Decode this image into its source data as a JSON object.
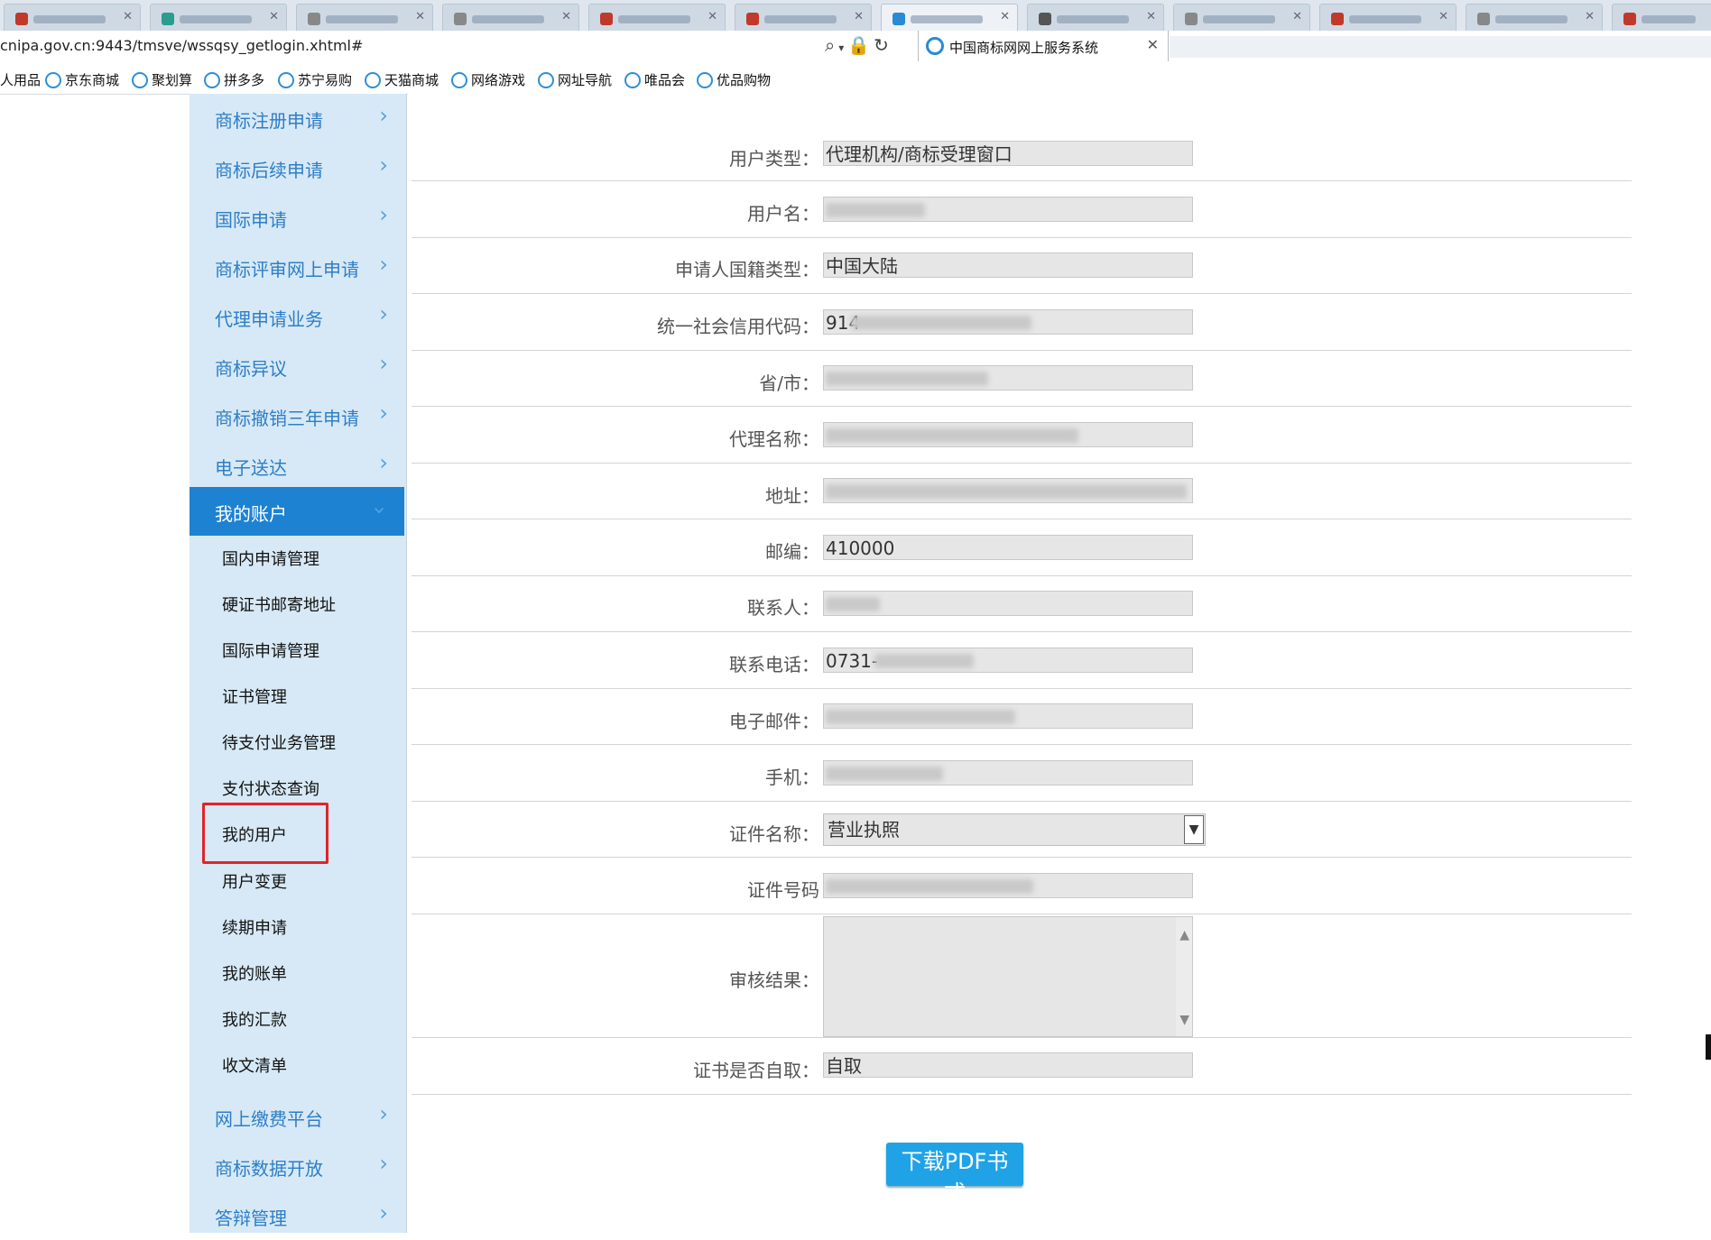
{
  "browser": {
    "url_visible": "cnipa.gov.cn:9443/tmsve/wssqsy_getlogin.xhtml#",
    "active_tab_title": "中国商标网网上服务系统",
    "favorites": [
      "人用品",
      "京东商城",
      "聚划算",
      "拼多多",
      "苏宁易购",
      "天猫商城",
      "网络游戏",
      "网址导航",
      "唯品会",
      "优品购物"
    ]
  },
  "sidebar": {
    "items": [
      {
        "label": "商标注册申请"
      },
      {
        "label": "商标后续申请"
      },
      {
        "label": "国际申请"
      },
      {
        "label": "商标评审网上申请"
      },
      {
        "label": "代理申请业务"
      },
      {
        "label": "商标异议"
      },
      {
        "label": "商标撤销三年申请"
      },
      {
        "label": "电子送达"
      },
      {
        "label": "我的账户"
      },
      {
        "label": "网上缴费平台"
      },
      {
        "label": "商标数据开放"
      },
      {
        "label": "答辩管理"
      }
    ],
    "active_index": 8,
    "submenu": [
      "国内申请管理",
      "硬证书邮寄地址",
      "国际申请管理",
      "证书管理",
      "待支付业务管理",
      "支付状态查询",
      "我的用户",
      "用户变更",
      "续期申请",
      "我的账单",
      "我的汇款",
      "收文清单"
    ],
    "highlighted_submenu": "我的用户"
  },
  "form": {
    "fields": [
      {
        "label": "用户类型：",
        "value": "代理机构/商标受理窗口"
      },
      {
        "label": "用户名：",
        "value": ""
      },
      {
        "label": "申请人国籍类型：",
        "value": "中国大陆"
      },
      {
        "label": "统一社会信用代码：",
        "value": "914"
      },
      {
        "label": "省/市：",
        "value": ""
      },
      {
        "label": "代理名称：",
        "value": ""
      },
      {
        "label": "地址：",
        "value": ""
      },
      {
        "label": "邮编：",
        "value": "410000"
      },
      {
        "label": "联系人：",
        "value": ""
      },
      {
        "label": "联系电话：",
        "value": "0731-"
      },
      {
        "label": "电子邮件：",
        "value": ""
      },
      {
        "label": "手机：",
        "value": ""
      },
      {
        "label": "证件名称：",
        "value": "营业执照"
      },
      {
        "label": "证件号码",
        "value": ""
      },
      {
        "label": "审核结果：",
        "value": ""
      },
      {
        "label": "证书是否自取：",
        "value": "自取"
      }
    ],
    "download_button": "下载PDF书式"
  },
  "colors": {
    "sidebar_bg": "#d7e9f6",
    "sidebar_link": "#2e7ec7",
    "active_item": "#1e82d2",
    "button": "#20a2e6",
    "highlight": "#e0242a"
  }
}
